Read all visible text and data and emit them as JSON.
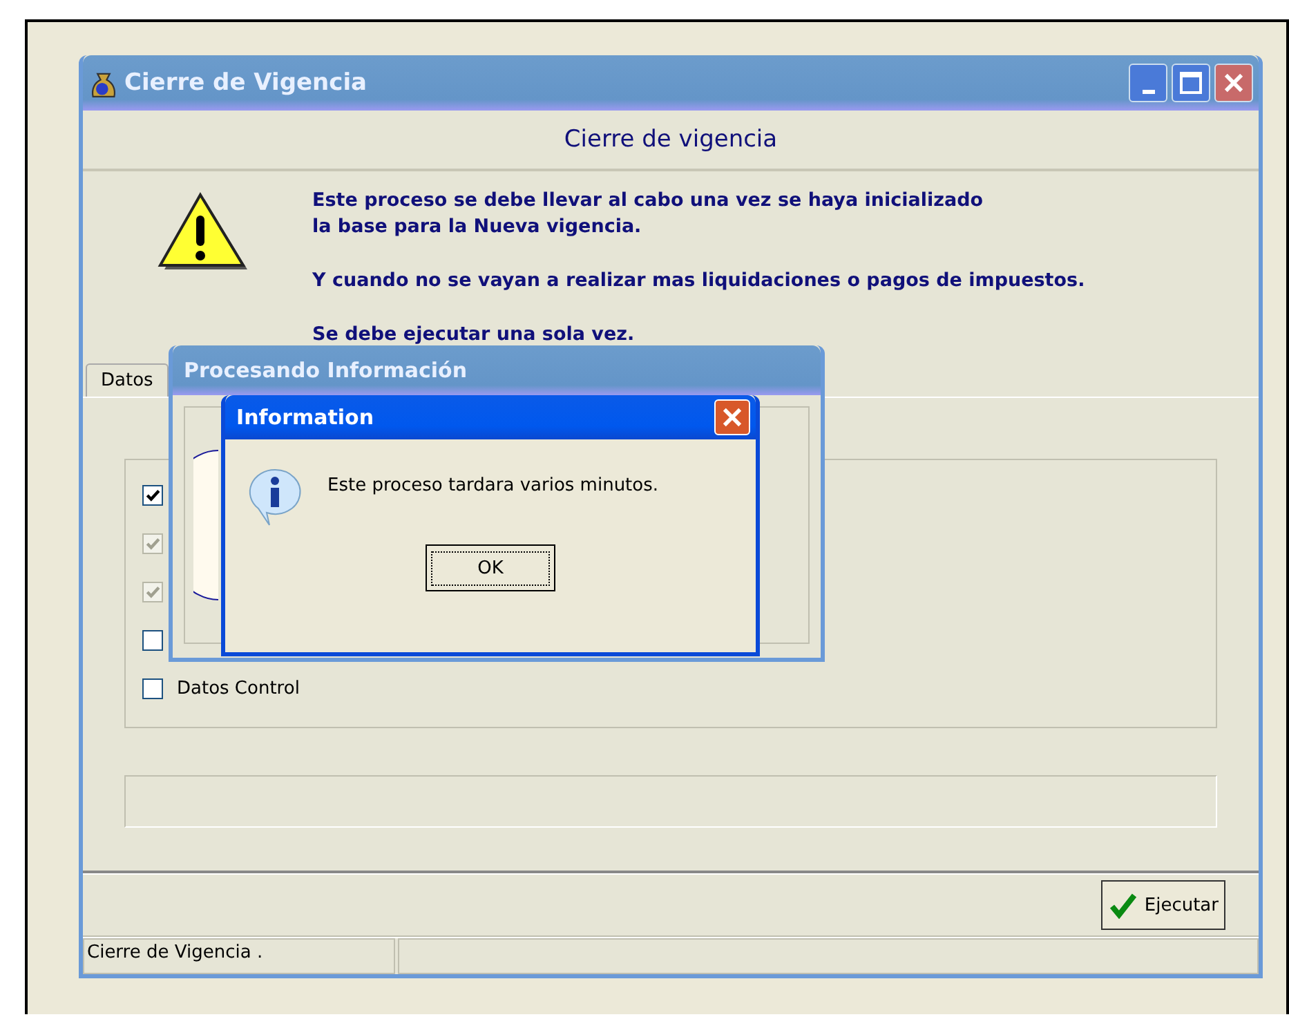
{
  "window": {
    "title": "Cierre de Vigencia"
  },
  "header": "Cierre de vigencia",
  "messages": [
    "Este proceso se debe llevar al cabo una vez se haya inicializado\nla base para la Nueva vigencia.",
    "Y cuando no se vayan a realizar mas liquidaciones o pagos de impuestos.",
    "Se debe ejecutar una sola vez."
  ],
  "tabs": [
    {
      "label": "Datos",
      "selected": true
    }
  ],
  "options": [
    {
      "checked": true,
      "disabled": false
    },
    {
      "checked": true,
      "disabled": true
    },
    {
      "checked": true,
      "disabled": true
    },
    {
      "checked": false,
      "disabled": false
    },
    {
      "label": "Datos Control",
      "checked": false,
      "disabled": false
    }
  ],
  "buttons": [
    {
      "label": "Ejecutar"
    }
  ],
  "status_bar": [
    "Cierre de Vigencia ."
  ],
  "progress_window": {
    "title": "Procesando Información"
  },
  "dialog": {
    "title": "Information",
    "message": "Este proceso tardara varios minutos.",
    "button": "OK"
  }
}
